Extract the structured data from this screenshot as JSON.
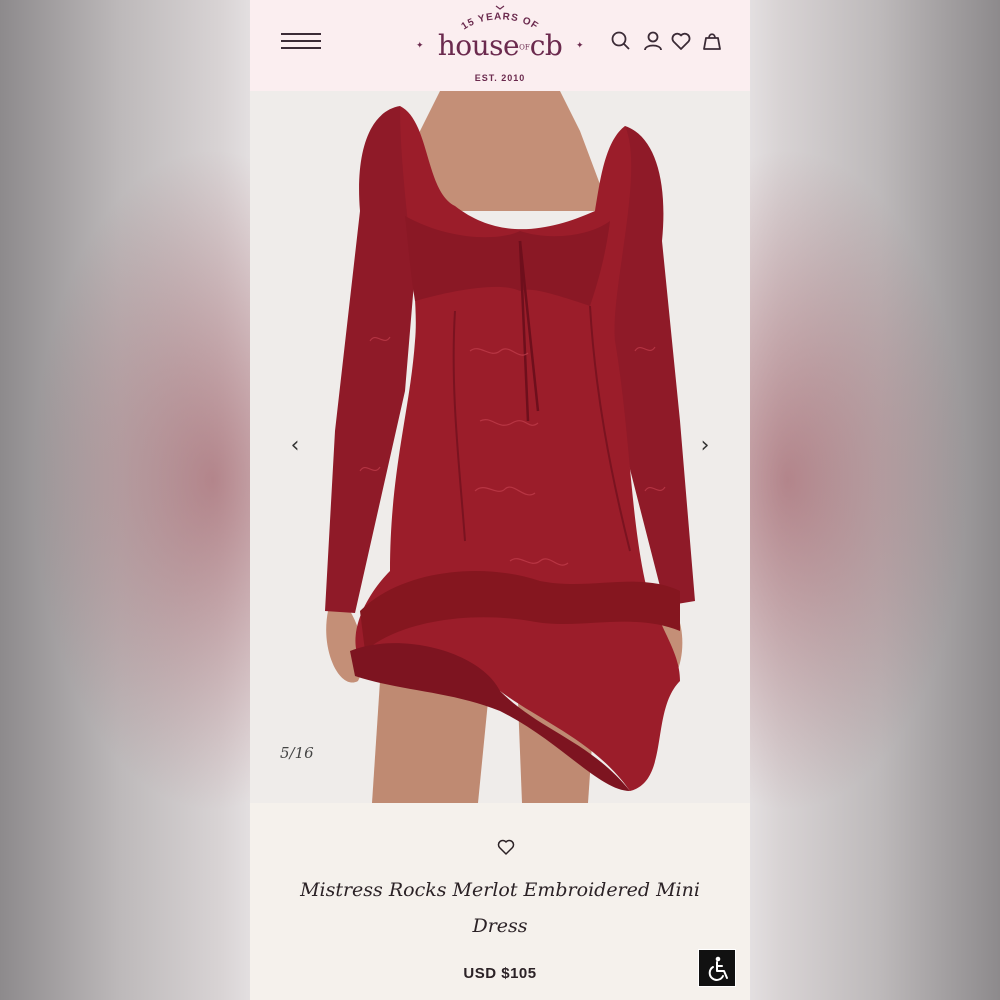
{
  "brand": {
    "anniversary": "15 YEARS OF",
    "wordmark_main": "house",
    "wordmark_of": "OF",
    "wordmark_end": "cb",
    "established": "EST. 2010",
    "color": "#6b2a4e"
  },
  "header": {
    "menu_icon": "hamburger-icon",
    "icons": [
      "search-icon",
      "account-icon",
      "heart-icon",
      "bag-icon"
    ]
  },
  "gallery": {
    "prev_arrow": "‹",
    "next_arrow": "›",
    "counter": "5/16",
    "dress_color": "#9b1d2a"
  },
  "product": {
    "title": "Mistress Rocks Merlot Embroidered Mini Dress",
    "price": "USD $105",
    "wishlist_icon": "heart-outline-icon"
  },
  "accessibility": {
    "icon": "wheelchair-icon"
  }
}
